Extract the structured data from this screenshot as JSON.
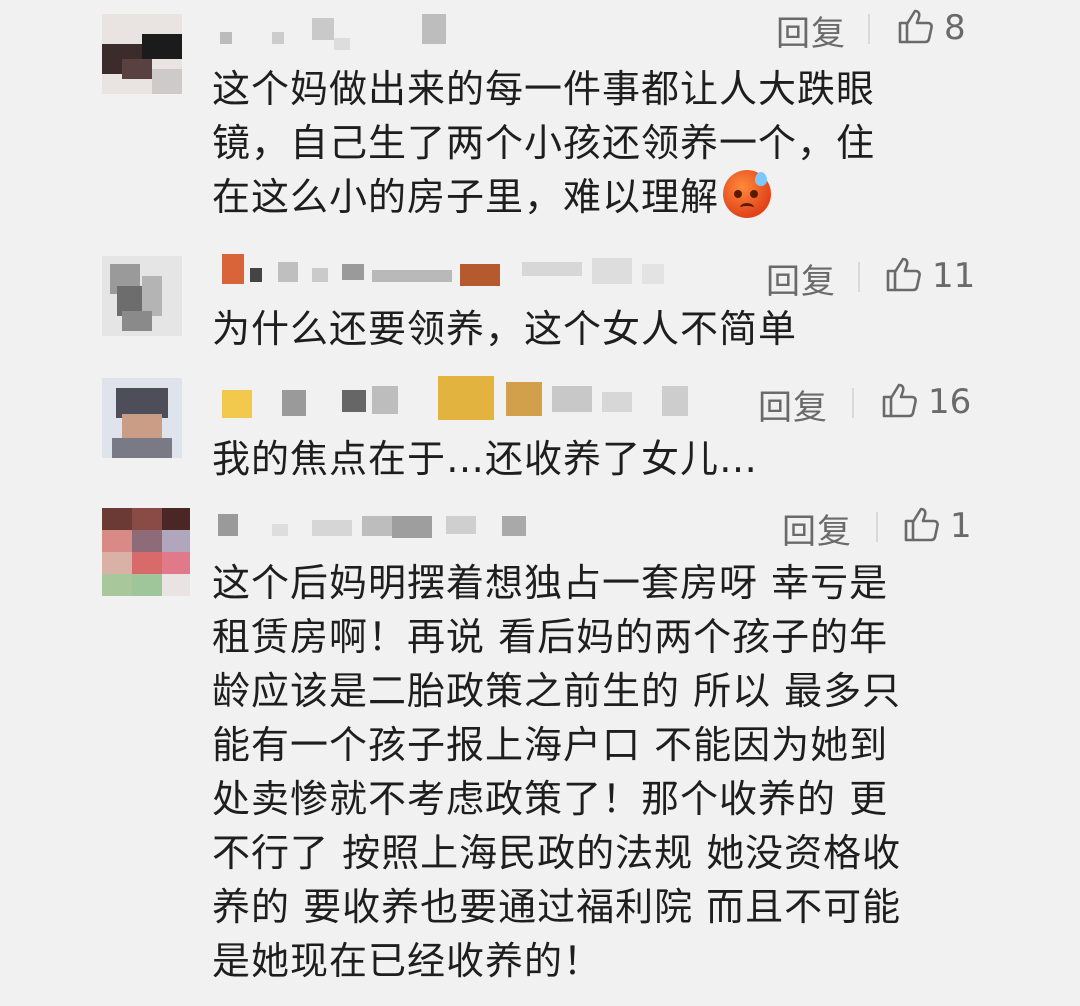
{
  "comments": [
    {
      "reply_label": "回复",
      "likes": "8",
      "lines": [
        "这个妈做出来的每一件事都让人大跌眼",
        "镜，自己生了两个小孩还领养一个，住",
        "在这么小的房子里，难以理解"
      ],
      "emoji": "sweating-angry-face"
    },
    {
      "reply_label": "回复",
      "likes": "11",
      "lines": [
        "为什么还要领养，这个女人不简单"
      ]
    },
    {
      "reply_label": "回复",
      "likes": "16",
      "lines": [
        "我的焦点在于…还收养了女儿…"
      ]
    },
    {
      "reply_label": "回复",
      "likes": "1",
      "lines": [
        "这个后妈明摆着想独占一套房呀 幸亏是",
        "租赁房啊！再说 看后妈的两个孩子的年",
        "龄应该是二胎政策之前生的 所以 最多只",
        "能有一个孩子报上海户口 不能因为她到",
        "处卖惨就不考虑政策了！那个收养的 更",
        "不行了 按照上海民政的法规 她没资格收",
        "养的 要收养也要通过福利院 而且不可能",
        "是她现在已经收养的！"
      ]
    }
  ],
  "colors": {
    "background": "#f1f1f1",
    "text": "#1e1e1e",
    "meta": "#6a6a6a"
  },
  "icons": {
    "like": "thumbs-up-icon"
  }
}
